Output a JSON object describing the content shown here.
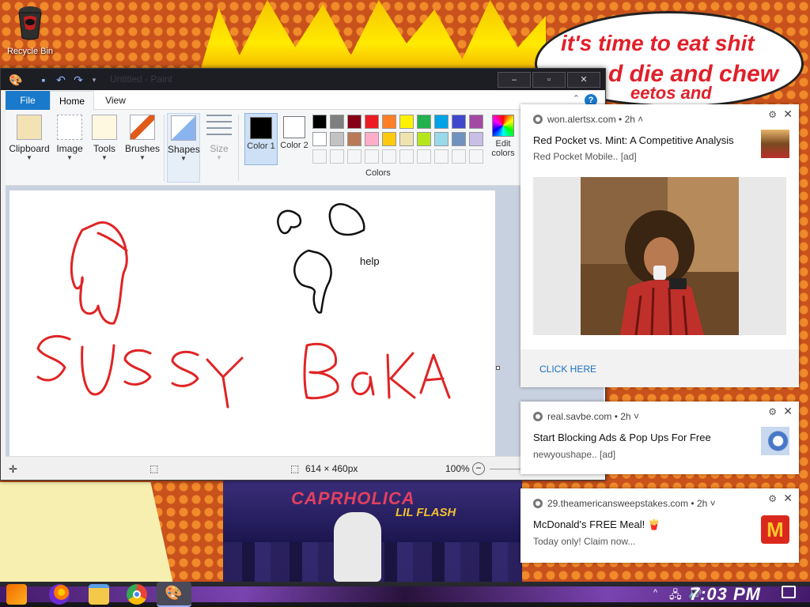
{
  "desktop": {
    "recycle_bin_label": "Recycle Bin",
    "speech_bubble": [
      "it's time to eat shit",
      "d die and chew",
      "eetos and"
    ],
    "poster_title": "CAPRHOLICA",
    "poster_subtitle": "LIL FLASH"
  },
  "paint": {
    "window_title": "Untitled - Paint",
    "tabs": {
      "file": "File",
      "home": "Home",
      "view": "View"
    },
    "groups": {
      "clipboard": "Clipboard",
      "image": "Image",
      "tools": "Tools",
      "brushes": "Brushes",
      "shapes": "Shapes",
      "size": "Size",
      "color1": "Color 1",
      "color2": "Color 2",
      "colors": "Colors",
      "edit_colors": "Edit colors"
    },
    "palette_row1": [
      "#000000",
      "#7f7f7f",
      "#880015",
      "#ed1c24",
      "#ff7f27",
      "#fff200",
      "#22b14c",
      "#00a2e8",
      "#3f48cc",
      "#a349a4"
    ],
    "palette_row2": [
      "#ffffff",
      "#c3c3c3",
      "#b97a57",
      "#ffaec9",
      "#ffc90e",
      "#efe4b0",
      "#b5e61d",
      "#99d9ea",
      "#7092be",
      "#c8bfe7"
    ],
    "color1_value": "#000000",
    "color2_value": "#ffffff",
    "canvas_text": "help",
    "status": {
      "dimensions": "614 × 460px",
      "zoom": "100%"
    }
  },
  "notifications": [
    {
      "source": "won.alertsx.com",
      "age": "2h",
      "chevron": "^",
      "title": "Red Pocket vs. Mint: A Competitive Analysis",
      "subtitle": "Red Pocket Mobile.. [ad]",
      "action": "CLICK HERE"
    },
    {
      "source": "real.savbe.com",
      "age": "2h",
      "chevron": "v",
      "title": "Start Blocking Ads & Pop Ups For Free",
      "subtitle": "newyoushape.. [ad]"
    },
    {
      "source": "29.theamericansweepstakes.com",
      "age": "2h",
      "chevron": "v",
      "title": "McDonald's FREE Meal! 🍟",
      "subtitle": "Today only! Claim now..."
    }
  ],
  "taskbar": {
    "clock": "7:03 PM"
  },
  "colors": {
    "accent": "#1979ca",
    "ink_red": "#e02424",
    "link_blue": "#1a6fc0"
  }
}
